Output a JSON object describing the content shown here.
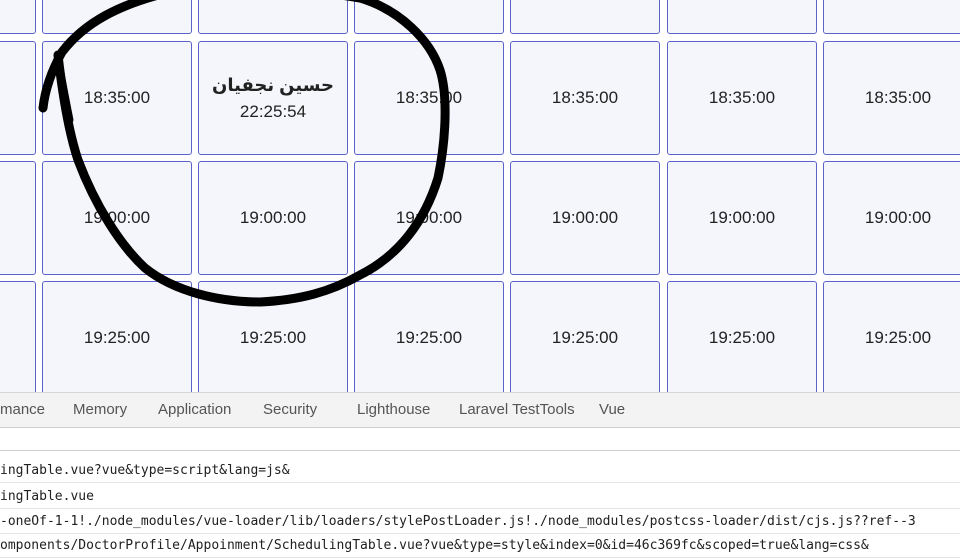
{
  "schedule": {
    "rows": [
      {
        "cells": [
          {
            "time": ""
          },
          {
            "time": ""
          },
          {
            "time": ""
          },
          {
            "time": ""
          },
          {
            "time": ""
          },
          {
            "time": ""
          },
          {
            "time": ""
          }
        ]
      },
      {
        "cells": [
          {
            "time": ""
          },
          {
            "time": "18:35:00"
          },
          {
            "name": "حسين نجفيان",
            "time": "22:25:54"
          },
          {
            "time": "18:35:00"
          },
          {
            "time": "18:35:00"
          },
          {
            "time": "18:35:00"
          },
          {
            "time": "18:35:00"
          }
        ]
      },
      {
        "cells": [
          {
            "time": ""
          },
          {
            "time": "19:00:00"
          },
          {
            "time": "19:00:00"
          },
          {
            "time": "19:00:00"
          },
          {
            "time": "19:00:00"
          },
          {
            "time": "19:00:00"
          },
          {
            "time": "19:00:00"
          }
        ]
      },
      {
        "cells": [
          {
            "time": ""
          },
          {
            "time": "19:25:00"
          },
          {
            "time": "19:25:00"
          },
          {
            "time": "19:25:00"
          },
          {
            "time": "19:25:00"
          },
          {
            "time": "19:25:00"
          },
          {
            "time": "19:25:00"
          }
        ]
      }
    ]
  },
  "devtools": {
    "tabs": [
      {
        "label": "mance"
      },
      {
        "label": "Memory"
      },
      {
        "label": "Application"
      },
      {
        "label": "Security"
      },
      {
        "label": "Lighthouse"
      },
      {
        "label": "Laravel TestTools"
      },
      {
        "label": "Vue"
      }
    ],
    "filter_value": "",
    "lines": [
      "ingTable.vue?vue&type=script&lang=js&",
      "ingTable.vue",
      "-oneOf-1-1!./node_modules/vue-loader/lib/loaders/stylePostLoader.js!./node_modules/postcss-loader/dist/cjs.js??ref--3",
      "omponents/DoctorProfile/Appoinment/SchedulingTable.vue?vue&type=style&index=0&id=46c369fc&scoped=true&lang=css&"
    ]
  },
  "colors": {
    "cell_border": "#5b63c9",
    "cell_bg": "#f5f6fb",
    "annotation_stroke": "#000000"
  }
}
